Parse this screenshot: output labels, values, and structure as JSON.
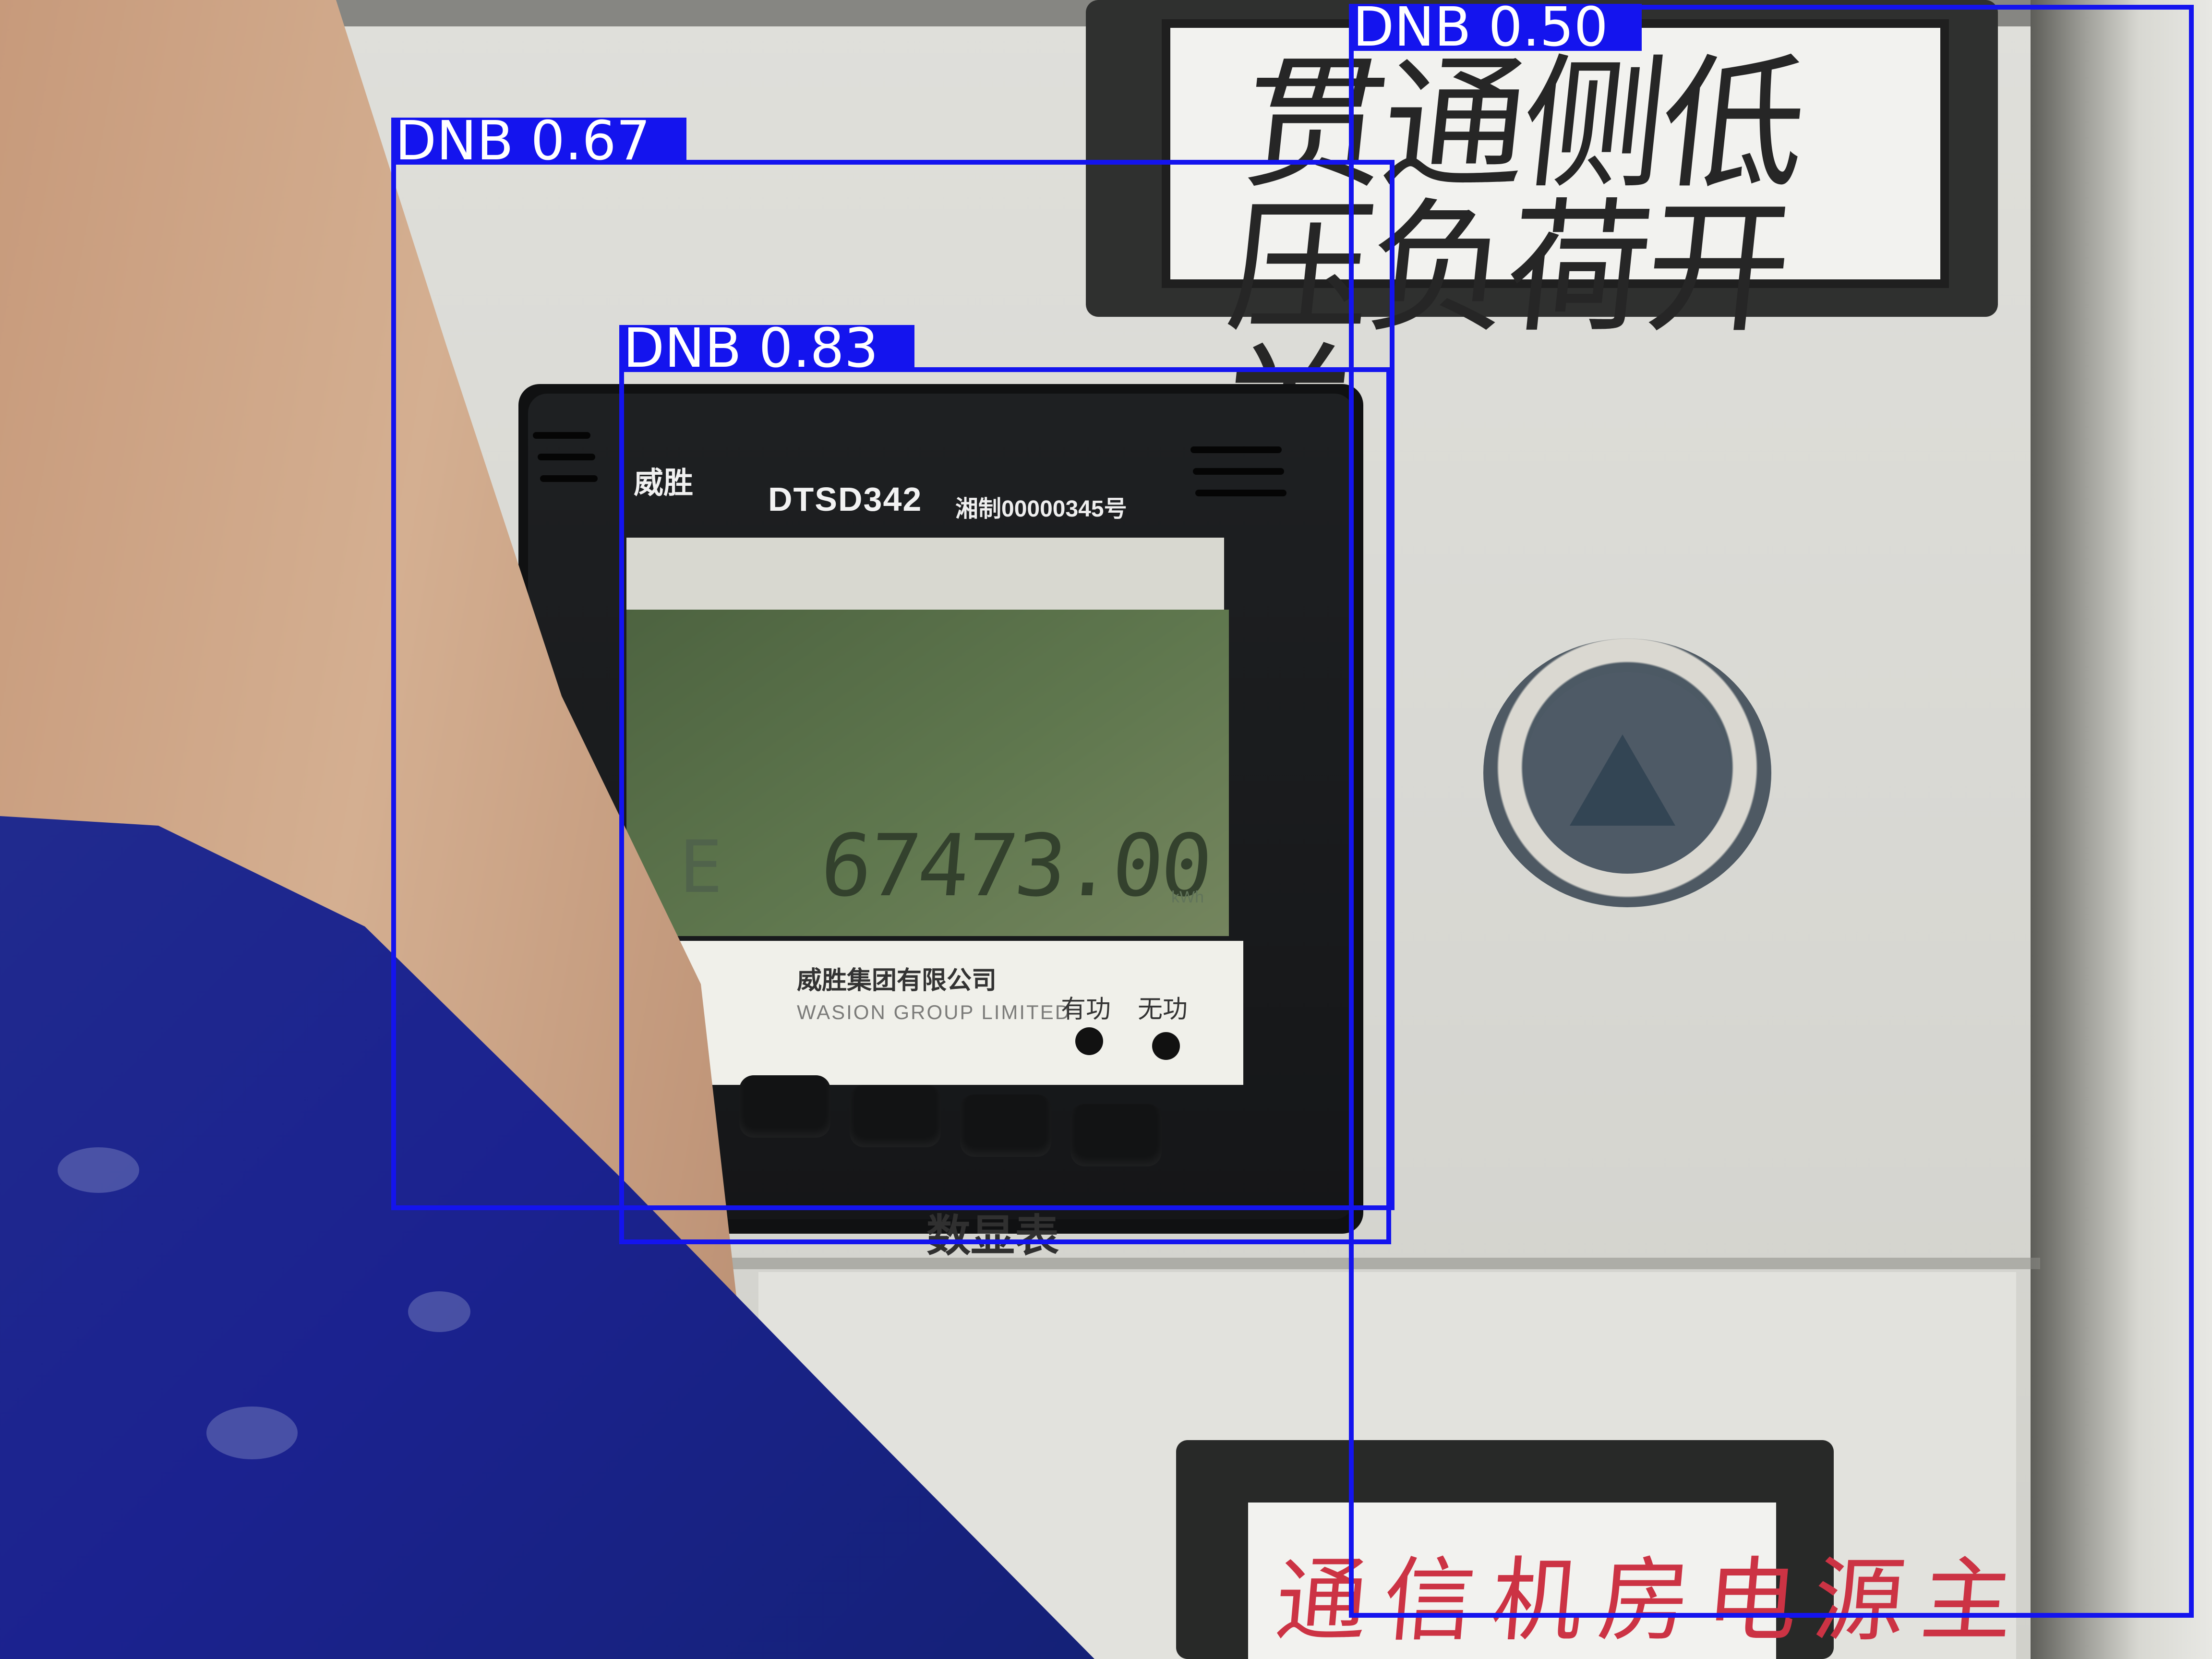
{
  "scene": {
    "cabinet_label": "贯通侧低压负荷开关",
    "meter": {
      "brand": "威胜",
      "model": "DTSD342",
      "approval": "湘制00000345号",
      "reading": "67473.00",
      "mode": "E",
      "unit": "kWh",
      "maker_cn": "威胜集团有限公司",
      "maker_en": "WASION GROUP LIMITED",
      "indicator_1": "有功",
      "indicator_2": "无功",
      "caption": "数显表"
    },
    "lower_label": "通信机房电源主"
  },
  "detections": [
    {
      "class": "DNB",
      "score": "0.50",
      "color": "#1414ee"
    },
    {
      "class": "DNB",
      "score": "0.67",
      "color": "#1414ee"
    },
    {
      "class": "DNB",
      "score": "0.83",
      "color": "#1414ee"
    }
  ]
}
